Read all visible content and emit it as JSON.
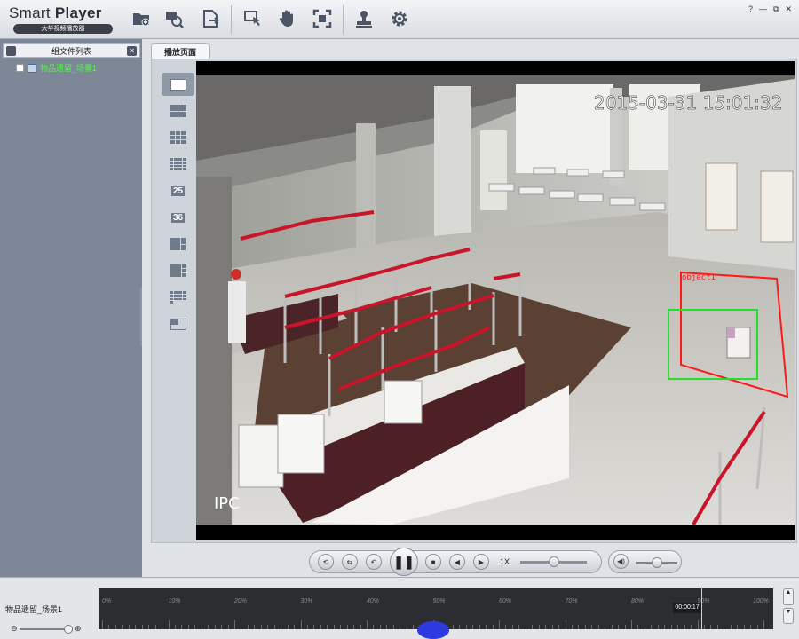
{
  "app": {
    "name_light": "Smart ",
    "name_bold": "Player",
    "subtitle": "大华视频播放器"
  },
  "window_controls": [
    "?",
    "—",
    "⧉",
    "✕"
  ],
  "toolbar": {
    "icons": [
      "open-folder-icon",
      "search-file-icon",
      "export-icon",
      "cursor-icon",
      "hand-icon",
      "fullscreen-icon",
      "stamp-icon",
      "gear-icon"
    ]
  },
  "sidebar": {
    "header": "组文件列表",
    "items": [
      {
        "label": "物品遗留_场景1"
      }
    ]
  },
  "tabs": [
    {
      "label": "播放页面"
    }
  ],
  "layouts": [
    "1",
    "4",
    "9",
    "16",
    "25",
    "36",
    "6",
    "8",
    "13",
    "9b"
  ],
  "layout_numbers": {
    "n25": "25",
    "n36": "36"
  },
  "video": {
    "timestamp": "2015-03-31 15:01:32",
    "channel": "IPC",
    "object_label": "object1",
    "rule_color": "#ff1a1a",
    "box_color": "#22e02a"
  },
  "controls": {
    "speed": "1X",
    "play_state": "paused"
  },
  "timeline": {
    "labels": [
      "0%",
      "10%",
      "20%",
      "30%",
      "40%",
      "50%",
      "60%",
      "70%",
      "80%",
      "90%",
      "100%"
    ],
    "current_time": "00:00:17"
  },
  "bottom": {
    "scene_label": "物品遗留_场景1"
  }
}
